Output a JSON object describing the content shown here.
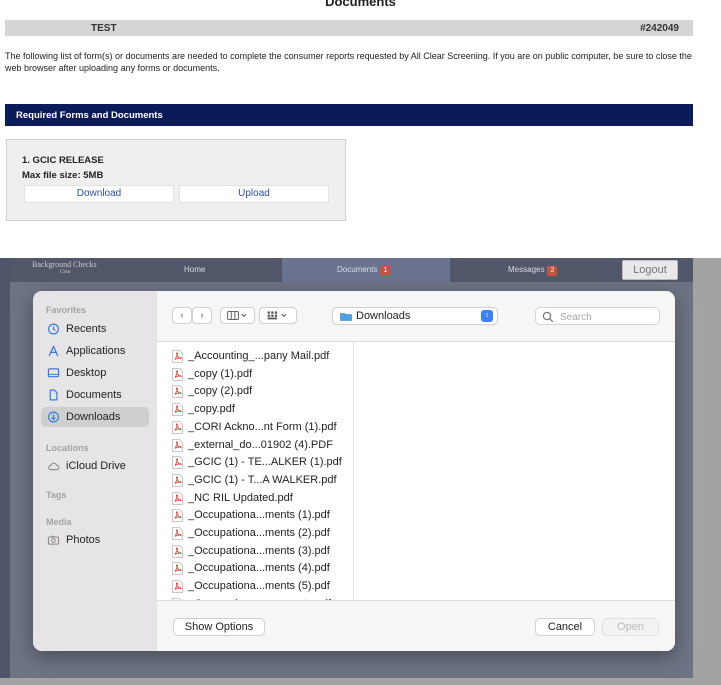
{
  "document_page": {
    "heading": "Documents",
    "subject_name": "TEST",
    "order_number": "#242049",
    "intro_text": "The following list of form(s) or documents are needed to complete the consumer reports requested by All Clear Screening. If you are on public computer, be sure to close the web browser after uploading any forms or documents.",
    "section_title": "Required Forms and Documents",
    "form": {
      "name": "1. GCIC RELEASE",
      "max_size": "Max file size: 5MB",
      "download_label": "Download",
      "upload_label": "Upload"
    }
  },
  "site_nav": {
    "logo_line1": "Background Checks",
    "logo_line2": "Clear",
    "home": "Home",
    "documents": "Documents",
    "documents_badge": "1",
    "messages": "Messages",
    "messages_badge": "2",
    "logout": "Logout"
  },
  "file_dialog": {
    "sidebar": {
      "favorites_header": "Favorites",
      "favorites": [
        {
          "label": "Recents",
          "icon": "clock-icon"
        },
        {
          "label": "Applications",
          "icon": "applications-icon"
        },
        {
          "label": "Desktop",
          "icon": "desktop-icon"
        },
        {
          "label": "Documents",
          "icon": "document-icon"
        },
        {
          "label": "Downloads",
          "icon": "downloads-icon",
          "selected": true
        }
      ],
      "locations_header": "Locations",
      "locations": [
        {
          "label": "iCloud Drive",
          "icon": "cloud-icon"
        }
      ],
      "tags_header": "Tags",
      "media_header": "Media",
      "media": [
        {
          "label": "Photos",
          "icon": "camera-icon"
        }
      ]
    },
    "toolbar": {
      "current_folder": "Downloads",
      "search_placeholder": "Search"
    },
    "files": [
      "_Accounting_...pany Mail.pdf",
      "_copy (1).pdf",
      "_copy (2).pdf",
      "_copy.pdf",
      "_CORI Ackno...nt Form (1).pdf",
      "_external_do...01902 (4).PDF",
      "_GCIC (1) - TE...ALKER (1).pdf",
      "_GCIC (1) - T...A WALKER.pdf",
      "_NC RIL Updated.pdf",
      "_Occupationa...ments (1).pdf",
      "_Occupationa...ments (2).pdf",
      "_Occupationa...ments (3).pdf",
      "_Occupationa...ments (4).pdf",
      "_Occupationa...ments (5).pdf",
      "_Occupationa...ocuments.pdf"
    ],
    "footer": {
      "show_options": "Show Options",
      "cancel": "Cancel",
      "open": "Open"
    }
  }
}
